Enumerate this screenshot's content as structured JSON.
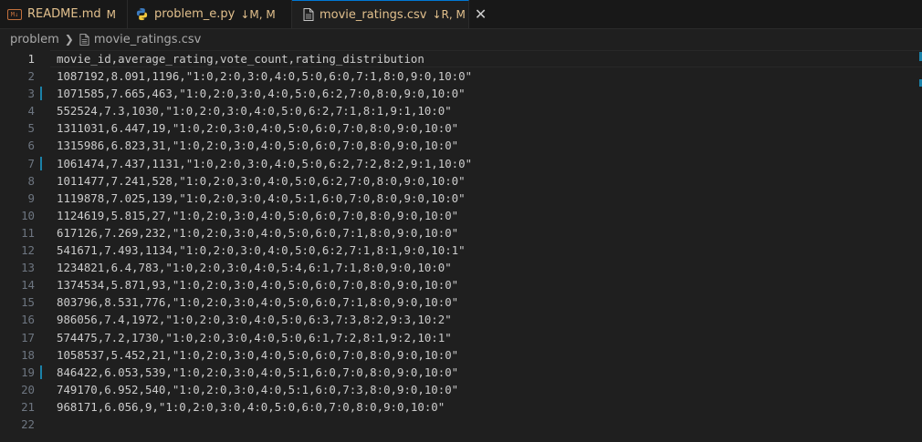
{
  "tabs": [
    {
      "name": "README.md",
      "badge": "M",
      "icon": "markdown-icon"
    },
    {
      "name": "problem_e.py",
      "badge": "↓M, M",
      "icon": "python-icon"
    },
    {
      "name": "movie_ratings.csv",
      "badge": "↓R, M",
      "icon": "file-icon",
      "active": true
    }
  ],
  "close_glyph": "✕",
  "breadcrumb": {
    "folder": "problem",
    "file": "movie_ratings.csv"
  },
  "lines": [
    "movie_id,average_rating,vote_count,rating_distribution",
    "1087192,8.091,1196,\"1:0,2:0,3:0,4:0,5:0,6:0,7:1,8:0,9:0,10:0\"",
    "1071585,7.665,463,\"1:0,2:0,3:0,4:0,5:0,6:2,7:0,8:0,9:0,10:0\"",
    "552524,7.3,1030,\"1:0,2:0,3:0,4:0,5:0,6:2,7:1,8:1,9:1,10:0\"",
    "1311031,6.447,19,\"1:0,2:0,3:0,4:0,5:0,6:0,7:0,8:0,9:0,10:0\"",
    "1315986,6.823,31,\"1:0,2:0,3:0,4:0,5:0,6:0,7:0,8:0,9:0,10:0\"",
    "1061474,7.437,1131,\"1:0,2:0,3:0,4:0,5:0,6:2,7:2,8:2,9:1,10:0\"",
    "1011477,7.241,528,\"1:0,2:0,3:0,4:0,5:0,6:2,7:0,8:0,9:0,10:0\"",
    "1119878,7.025,139,\"1:0,2:0,3:0,4:0,5:1,6:0,7:0,8:0,9:0,10:0\"",
    "1124619,5.815,27,\"1:0,2:0,3:0,4:0,5:0,6:0,7:0,8:0,9:0,10:0\"",
    "617126,7.269,232,\"1:0,2:0,3:0,4:0,5:0,6:0,7:1,8:0,9:0,10:0\"",
    "541671,7.493,1134,\"1:0,2:0,3:0,4:0,5:0,6:2,7:1,8:1,9:0,10:1\"",
    "1234821,6.4,783,\"1:0,2:0,3:0,4:0,5:4,6:1,7:1,8:0,9:0,10:0\"",
    "1374534,5.871,93,\"1:0,2:0,3:0,4:0,5:0,6:0,7:0,8:0,9:0,10:0\"",
    "803796,8.531,776,\"1:0,2:0,3:0,4:0,5:0,6:0,7:1,8:0,9:0,10:0\"",
    "986056,7.4,1972,\"1:0,2:0,3:0,4:0,5:0,6:3,7:3,8:2,9:3,10:2\"",
    "574475,7.2,1730,\"1:0,2:0,3:0,4:0,5:0,6:1,7:2,8:1,9:2,10:1\"",
    "1058537,5.452,21,\"1:0,2:0,3:0,4:0,5:0,6:0,7:0,8:0,9:0,10:0\"",
    "846422,6.053,539,\"1:0,2:0,3:0,4:0,5:1,6:0,7:0,8:0,9:0,10:0\"",
    "749170,6.952,540,\"1:0,2:0,3:0,4:0,5:1,6:0,7:3,8:0,9:0,10:0\"",
    "968171,6.056,9,\"1:0,2:0,3:0,4:0,5:0,6:0,7:0,8:0,9:0,10:0\"",
    ""
  ],
  "modified_lines": [
    3,
    7,
    19
  ],
  "current_line": 1,
  "colors": {
    "accent": "#0078d4",
    "modified_badge": "#e2c08d",
    "gutter_modified": "#1b81a8"
  }
}
